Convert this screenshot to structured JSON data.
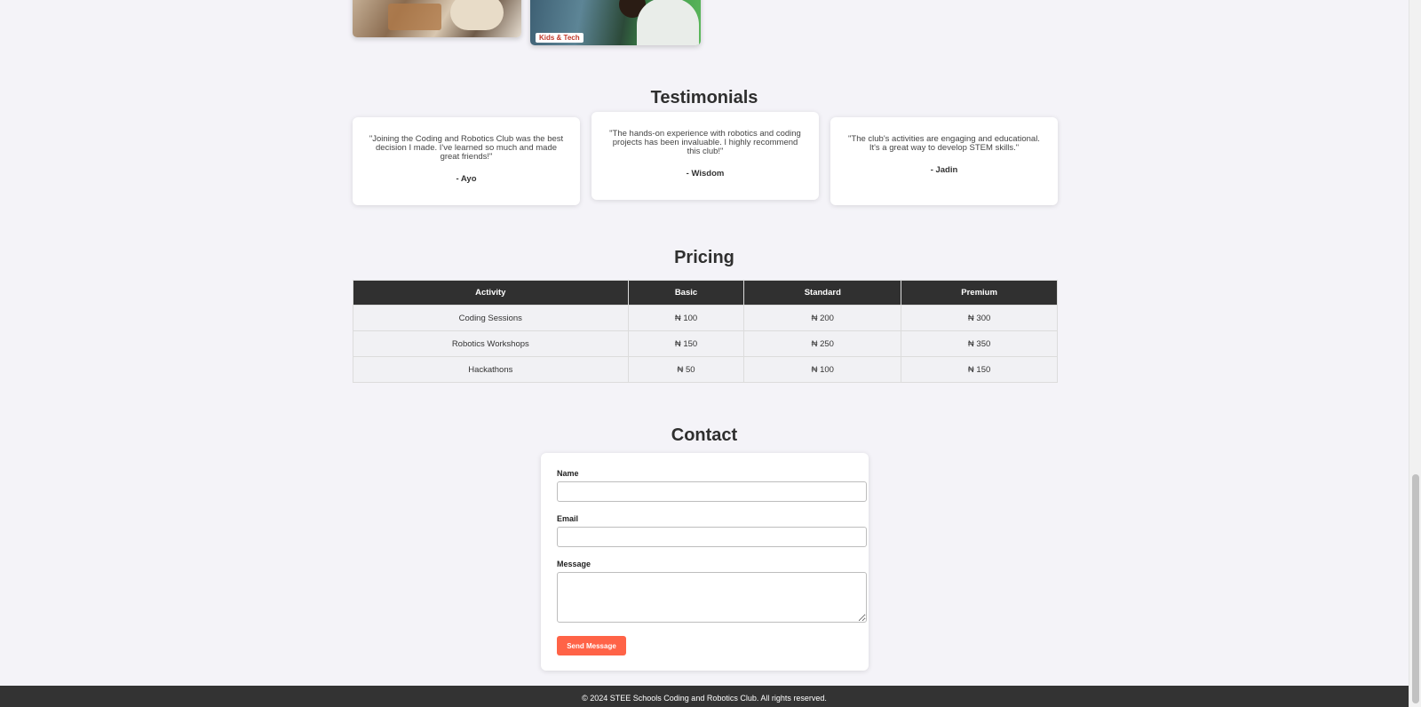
{
  "gallery": {
    "images": [
      {
        "name": "students-electronics-image",
        "tag": ""
      },
      {
        "name": "kids-tech-image",
        "tag": "Kids & Tech"
      }
    ]
  },
  "testimonials": {
    "title": "Testimonials",
    "items": [
      {
        "quote": "\"Joining the Coding and Robotics Club was the best decision I made. I've learned so much and made great friends!\"",
        "author": "- Ayo"
      },
      {
        "quote": "\"The hands-on experience with robotics and coding projects has been invaluable. I highly recommend this club!\"",
        "author": "- Wisdom"
      },
      {
        "quote": "\"The club's activities are engaging and educational. It's a great way to develop STEM skills.\"",
        "author": "- Jadin"
      }
    ]
  },
  "pricing": {
    "title": "Pricing",
    "headers": [
      "Activity",
      "Basic",
      "Standard",
      "Premium"
    ],
    "rows": [
      [
        "Coding Sessions",
        "₦ 100",
        "₦ 200",
        "₦ 300"
      ],
      [
        "Robotics Workshops",
        "₦ 150",
        "₦ 250",
        "₦ 350"
      ],
      [
        "Hackathons",
        "₦ 50",
        "₦ 100",
        "₦ 150"
      ]
    ]
  },
  "contact": {
    "title": "Contact",
    "name_label": "Name",
    "name_value": "",
    "email_label": "Email",
    "email_value": "",
    "message_label": "Message",
    "message_value": "",
    "send_label": "Send Message"
  },
  "footer": {
    "text": "© 2024 STEE Schools Coding and Robotics Club. All rights reserved."
  },
  "colors": {
    "accent": "#ff6347",
    "header_dark": "#303030",
    "background": "#f4f3f8"
  }
}
